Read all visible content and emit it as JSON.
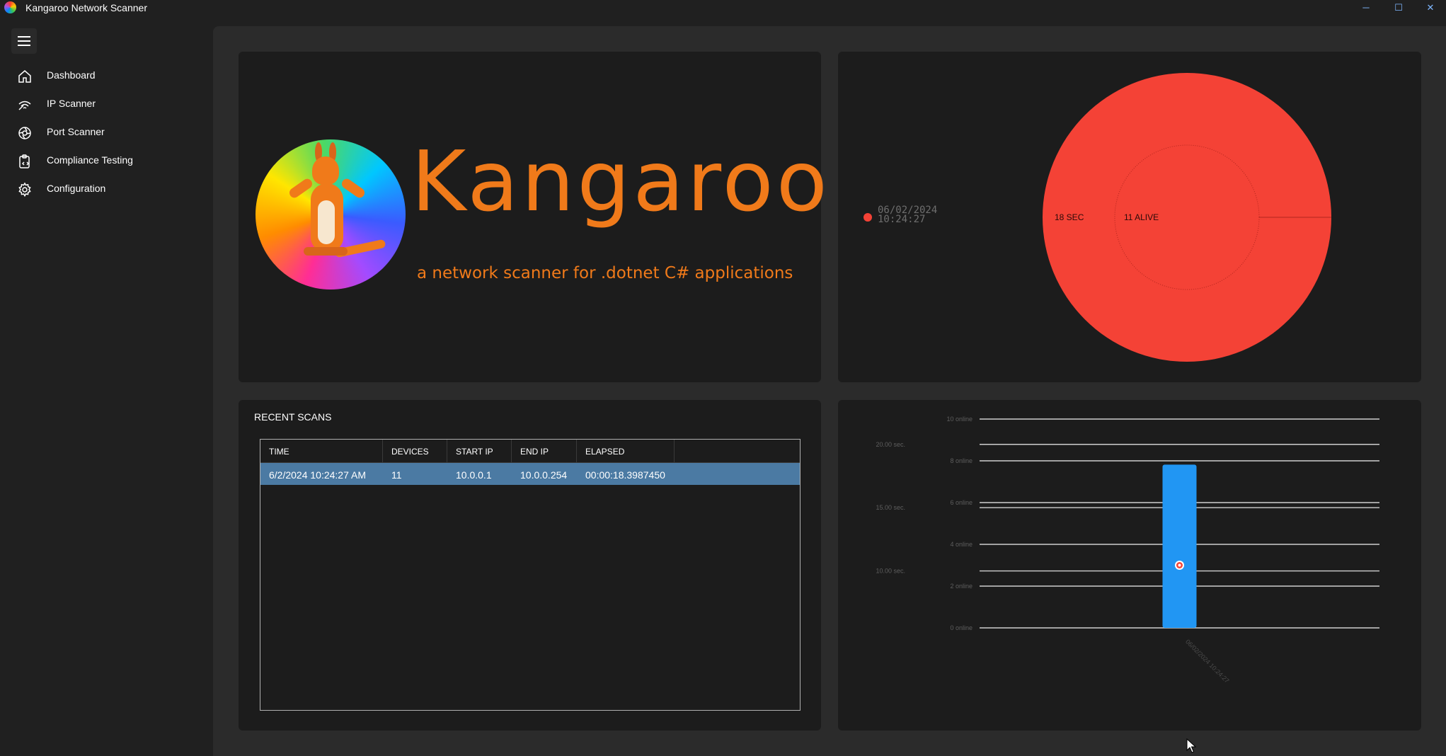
{
  "window": {
    "title": "Kangaroo Network Scanner",
    "minimize_glyph": "─",
    "maximize_glyph": "☐",
    "close_glyph": "✕"
  },
  "sidebar": {
    "items": [
      {
        "label": "Dashboard",
        "icon": "home-icon"
      },
      {
        "label": "IP Scanner",
        "icon": "wifi-icon"
      },
      {
        "label": "Port Scanner",
        "icon": "aperture-icon"
      },
      {
        "label": "Compliance Testing",
        "icon": "clipboard-code-icon"
      },
      {
        "label": "Configuration",
        "icon": "gear-icon"
      }
    ]
  },
  "logo": {
    "title": "Kangaroo",
    "subtitle": "a network scanner for .dotnet C# applications"
  },
  "pie": {
    "legend": {
      "date": "06/02/2024",
      "time": "10:24:27",
      "color": "#f44236"
    },
    "outer_label": "18 SEC",
    "inner_label": "11 ALIVE"
  },
  "recent_scans": {
    "title": "RECENT SCANS",
    "columns": [
      "TIME",
      "DEVICES",
      "START IP",
      "END IP",
      "ELAPSED"
    ],
    "rows": [
      [
        "6/2/2024 10:24:27 AM",
        "11",
        "10.0.0.1",
        "10.0.0.254",
        "00:00:18.3987450"
      ]
    ]
  },
  "chart_data": {
    "type": "bar",
    "categories": [
      "06/02/2024 10:24:27"
    ],
    "series": [
      {
        "values": [
          18.4
        ],
        "color": "#2196f3",
        "axis": "seconds"
      },
      {
        "values": [
          3
        ],
        "color": "#f44236",
        "axis": "online",
        "marker": "point"
      }
    ],
    "y_left": {
      "ticks": [
        "10.00 sec.",
        "15.00 sec.",
        "20.00 sec."
      ],
      "range": [
        5.5,
        22
      ]
    },
    "y_right": {
      "ticks": [
        "0 online",
        "2 online",
        "4 online",
        "6 online",
        "8 online",
        "10 online"
      ],
      "range": [
        0,
        10
      ]
    },
    "grid": true
  },
  "colors": {
    "accent_orange": "#f07a1a",
    "pie_red": "#f44236",
    "selected_row": "#4b7aa3",
    "bar_blue": "#2196f3"
  }
}
